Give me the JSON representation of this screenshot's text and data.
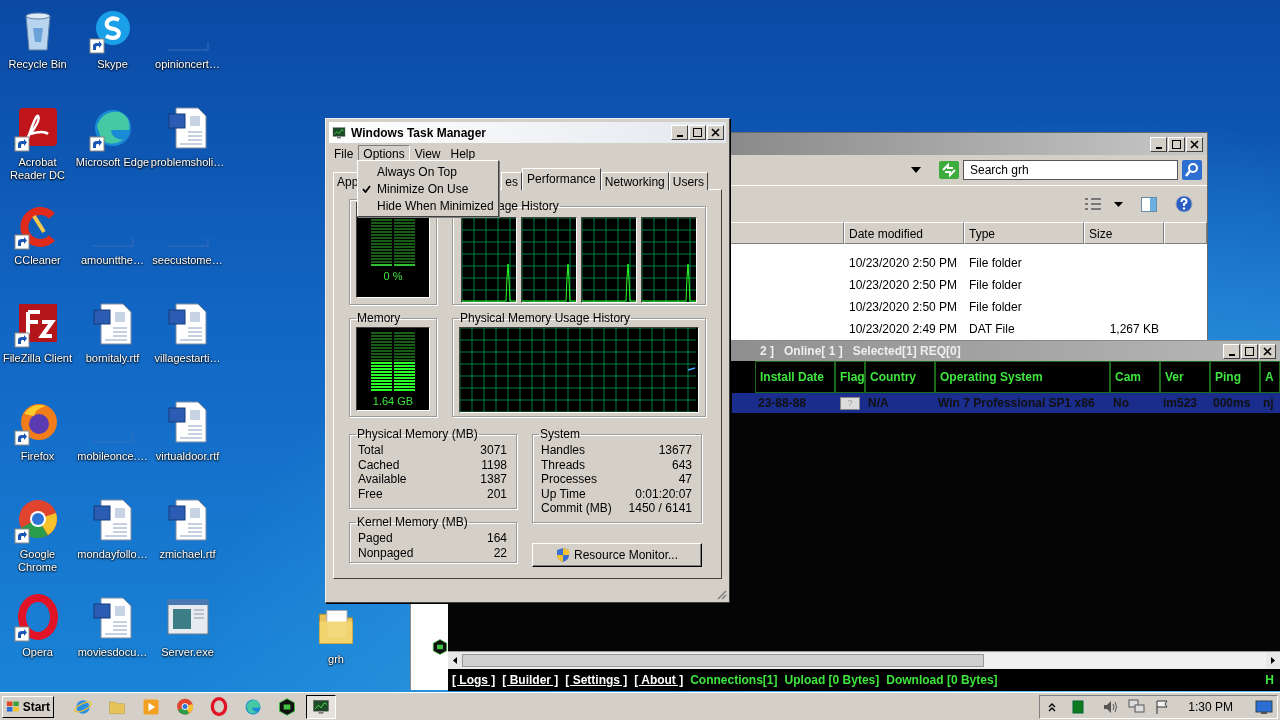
{
  "desktop": {
    "icons": [
      {
        "label": "Recycle Bin",
        "kind": "recycle",
        "shortcut": false
      },
      {
        "label": "Skype",
        "kind": "skype",
        "shortcut": true
      },
      {
        "label": "opinioncert…",
        "kind": "blank",
        "shortcut": false
      },
      {
        "label": "Acrobat Reader DC",
        "kind": "pdf",
        "shortcut": true
      },
      {
        "label": "Microsoft Edge",
        "kind": "edge",
        "shortcut": true
      },
      {
        "label": "problemsholi…",
        "kind": "word",
        "shortcut": false
      },
      {
        "label": "CCleaner",
        "kind": "ccleaner",
        "shortcut": true
      },
      {
        "label": "amountthe…",
        "kind": "blank",
        "shortcut": false
      },
      {
        "label": "seecustome…",
        "kind": "blank",
        "shortcut": false
      },
      {
        "label": "FileZilla Client",
        "kind": "filezilla",
        "shortcut": true
      },
      {
        "label": "bornitaly.rtf",
        "kind": "word",
        "shortcut": false
      },
      {
        "label": "villagestarti…",
        "kind": "word",
        "shortcut": false
      },
      {
        "label": "Firefox",
        "kind": "firefox",
        "shortcut": true
      },
      {
        "label": "mobileonce.…",
        "kind": "blank",
        "shortcut": false
      },
      {
        "label": "virtualdoor.rtf",
        "kind": "word",
        "shortcut": false
      },
      {
        "label": "Google Chrome",
        "kind": "chrome",
        "shortcut": true
      },
      {
        "label": "mondayfollo…",
        "kind": "word",
        "shortcut": false
      },
      {
        "label": "zmichael.rtf",
        "kind": "word",
        "shortcut": false
      },
      {
        "label": "Opera",
        "kind": "opera",
        "shortcut": true
      },
      {
        "label": "moviesdocu…",
        "kind": "word",
        "shortcut": false
      },
      {
        "label": "Server.exe",
        "kind": "exe",
        "shortcut": false
      }
    ],
    "folder_icon": {
      "label": "grh",
      "kind": "folder"
    }
  },
  "explorer": {
    "search": {
      "placeholder": "Search grh"
    },
    "columns": [
      "Date modified",
      "Type",
      "Size"
    ],
    "rows": [
      {
        "date": "10/23/2020 2:50 PM",
        "type": "File folder"
      },
      {
        "date": "10/23/2020 2:50 PM",
        "type": "File folder"
      },
      {
        "date": "10/23/2020 2:50 PM",
        "type": "File folder"
      },
      {
        "date": "10/23/2020 2:49 PM",
        "type": "DAT File",
        "size": "1,267 KB"
      }
    ]
  },
  "rat_window": {
    "title": "2 ]   Online[ 1 ]   Selected[1] REQ[0]",
    "columns": [
      {
        "label": "Install Date",
        "kind": "text"
      },
      {
        "label": "Flag",
        "kind": "flag"
      },
      {
        "label": "Country",
        "kind": "text"
      },
      {
        "label": "Operating System",
        "kind": "text"
      },
      {
        "label": "Cam",
        "kind": "text"
      },
      {
        "label": "Ver",
        "kind": "text"
      },
      {
        "label": "Ping",
        "kind": "text"
      },
      {
        "label": "A",
        "kind": "text"
      }
    ],
    "rows": [
      {
        "selected": true,
        "cells": [
          "23-88-88",
          "?",
          "N/A",
          "Win 7 Professional SP1 x86",
          "No",
          "im523",
          "000ms",
          "nj"
        ]
      }
    ],
    "links": [
      "[ Logs ]",
      "[ Builder ]",
      "[ Settings ]",
      "[ About ]"
    ],
    "stats": [
      "Connections[1]",
      "Upload [0 Bytes]",
      "Download [0 Bytes]"
    ],
    "status_end": "H"
  },
  "task_manager": {
    "title": "Windows Task Manager",
    "menu": [
      {
        "label": "File",
        "selected": false
      },
      {
        "label": "Options",
        "selected": true
      },
      {
        "label": "View",
        "selected": false
      },
      {
        "label": "Help",
        "selected": false
      }
    ],
    "options_menu": [
      {
        "label": "Always On Top",
        "checked": false
      },
      {
        "label": "Minimize On Use",
        "checked": true
      },
      {
        "label": "Hide When Minimized",
        "checked": false
      }
    ],
    "tabs": [
      {
        "label": "App",
        "selected": false
      },
      {
        "label": "es",
        "selected": false
      },
      {
        "label": "Performance",
        "selected": true
      },
      {
        "label": "Networking",
        "selected": false
      },
      {
        "label": "Users",
        "selected": false
      }
    ],
    "cpu": {
      "reading": "0 %",
      "level": 0
    },
    "cpu_history_title": "age History",
    "memory": {
      "title": "Memory",
      "reading": "1.64 GB",
      "level": 0.5
    },
    "memory_history_title": "Physical Memory Usage History",
    "physical_memory": {
      "title": "Physical Memory (MB)",
      "rows": [
        {
          "label": "Total",
          "value": "3071"
        },
        {
          "label": "Cached",
          "value": "1198"
        },
        {
          "label": "Available",
          "value": "1387"
        },
        {
          "label": "Free",
          "value": "201"
        }
      ]
    },
    "kernel_memory": {
      "title": "Kernel Memory (MB)",
      "rows": [
        {
          "label": "Paged",
          "value": "164"
        },
        {
          "label": "Nonpaged",
          "value": "22"
        }
      ]
    },
    "system": {
      "title": "System",
      "rows": [
        {
          "label": "Handles",
          "value": "13677"
        },
        {
          "label": "Threads",
          "value": "643"
        },
        {
          "label": "Processes",
          "value": "47"
        },
        {
          "label": "Up Time",
          "value": "0:01:20:07"
        },
        {
          "label": "Commit (MB)",
          "value": "1450 / 6141"
        }
      ]
    },
    "resource_button": "Resource Monitor..."
  },
  "taskbar": {
    "start": "Start",
    "apps": [
      {
        "kind": "ie",
        "selected": false
      },
      {
        "kind": "explorer",
        "selected": false
      },
      {
        "kind": "media",
        "selected": false
      },
      {
        "kind": "chrome",
        "selected": false
      },
      {
        "kind": "opera",
        "selected": false
      },
      {
        "kind": "edge",
        "selected": false
      },
      {
        "kind": "njrat",
        "selected": false
      },
      {
        "kind": "taskmgr",
        "selected": true
      }
    ],
    "clock": "1:30 PM"
  }
}
